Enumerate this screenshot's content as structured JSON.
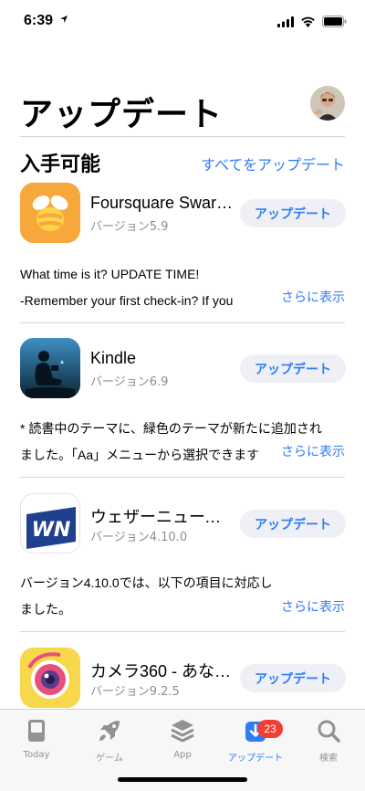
{
  "status": {
    "time": "6:39"
  },
  "header": {
    "title": "アップデート"
  },
  "section": {
    "title": "入手可能",
    "update_all": "すべてをアップデート"
  },
  "apps": [
    {
      "name": "Foursquare Swar…",
      "version": "バージョン5.9",
      "button": "アップデート",
      "note_lines": [
        "What time is it? UPDATE TIME!",
        "-Remember your first check-in? If you"
      ],
      "more": "さらに表示",
      "icon": "swarm-bee-icon"
    },
    {
      "name": "Kindle",
      "version": "バージョン6.9",
      "button": "アップデート",
      "note_lines": [
        "* 読書中のテーマに、緑色のテーマが新たに追加され",
        "ました。「Aa」メニューから選択できます"
      ],
      "more": "さらに表示",
      "icon": "kindle-reader-icon"
    },
    {
      "name": "ウェザーニュース…",
      "version": "バージョン4.10.0",
      "button": "アップデート",
      "note_lines": [
        "バージョン4.10.0では、以下の項目に対応し",
        "ました。"
      ],
      "more": "さらに表示",
      "icon": "weathernews-icon"
    },
    {
      "name": "カメラ360 - あな…",
      "version": "バージョン9.2.5",
      "button": "アップデート",
      "icon": "camera360-icon"
    }
  ],
  "tabs": [
    {
      "label": "Today",
      "icon": "today-icon"
    },
    {
      "label": "ゲーム",
      "icon": "rocket-icon"
    },
    {
      "label": "App",
      "icon": "stack-icon"
    },
    {
      "label": "アップデート",
      "icon": "update-download-icon",
      "badge": "23",
      "active": true
    },
    {
      "label": "検索",
      "icon": "search-icon"
    }
  ],
  "colors": {
    "accent": "#2f7cf6",
    "badge": "#f23c34",
    "button_bg": "#eff0f5"
  }
}
